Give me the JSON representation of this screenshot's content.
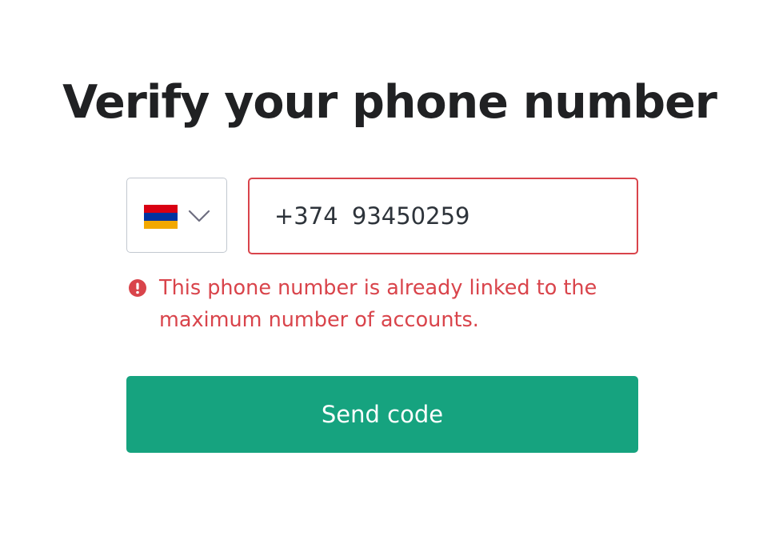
{
  "page": {
    "title": "Verify your phone number"
  },
  "country_select": {
    "flag_icon": "armenia-flag-icon",
    "flag_colors": [
      "#d90012",
      "#0033a0",
      "#f2a800"
    ],
    "chevron_icon": "chevron-down-icon"
  },
  "phone_input": {
    "value": "+374 93450259",
    "border_color": "#d9444b"
  },
  "error": {
    "icon": "exclamation-circle-icon",
    "message": "This phone number is already linked to the maximum number of accounts.",
    "color": "#d9444b"
  },
  "send_button": {
    "label": "Send code",
    "color": "#16a37f"
  }
}
